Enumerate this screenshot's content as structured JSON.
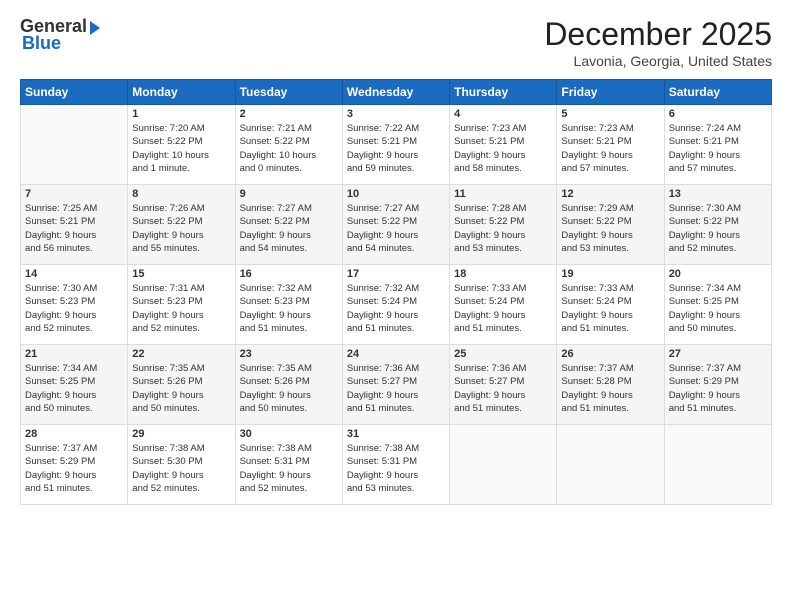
{
  "header": {
    "logo_general": "General",
    "logo_blue": "Blue",
    "month_year": "December 2025",
    "location": "Lavonia, Georgia, United States"
  },
  "weekdays": [
    "Sunday",
    "Monday",
    "Tuesday",
    "Wednesday",
    "Thursday",
    "Friday",
    "Saturday"
  ],
  "weeks": [
    [
      {
        "day": "",
        "info": ""
      },
      {
        "day": "1",
        "info": "Sunrise: 7:20 AM\nSunset: 5:22 PM\nDaylight: 10 hours\nand 1 minute."
      },
      {
        "day": "2",
        "info": "Sunrise: 7:21 AM\nSunset: 5:22 PM\nDaylight: 10 hours\nand 0 minutes."
      },
      {
        "day": "3",
        "info": "Sunrise: 7:22 AM\nSunset: 5:21 PM\nDaylight: 9 hours\nand 59 minutes."
      },
      {
        "day": "4",
        "info": "Sunrise: 7:23 AM\nSunset: 5:21 PM\nDaylight: 9 hours\nand 58 minutes."
      },
      {
        "day": "5",
        "info": "Sunrise: 7:23 AM\nSunset: 5:21 PM\nDaylight: 9 hours\nand 57 minutes."
      },
      {
        "day": "6",
        "info": "Sunrise: 7:24 AM\nSunset: 5:21 PM\nDaylight: 9 hours\nand 57 minutes."
      }
    ],
    [
      {
        "day": "7",
        "info": "Sunrise: 7:25 AM\nSunset: 5:21 PM\nDaylight: 9 hours\nand 56 minutes."
      },
      {
        "day": "8",
        "info": "Sunrise: 7:26 AM\nSunset: 5:22 PM\nDaylight: 9 hours\nand 55 minutes."
      },
      {
        "day": "9",
        "info": "Sunrise: 7:27 AM\nSunset: 5:22 PM\nDaylight: 9 hours\nand 54 minutes."
      },
      {
        "day": "10",
        "info": "Sunrise: 7:27 AM\nSunset: 5:22 PM\nDaylight: 9 hours\nand 54 minutes."
      },
      {
        "day": "11",
        "info": "Sunrise: 7:28 AM\nSunset: 5:22 PM\nDaylight: 9 hours\nand 53 minutes."
      },
      {
        "day": "12",
        "info": "Sunrise: 7:29 AM\nSunset: 5:22 PM\nDaylight: 9 hours\nand 53 minutes."
      },
      {
        "day": "13",
        "info": "Sunrise: 7:30 AM\nSunset: 5:22 PM\nDaylight: 9 hours\nand 52 minutes."
      }
    ],
    [
      {
        "day": "14",
        "info": "Sunrise: 7:30 AM\nSunset: 5:23 PM\nDaylight: 9 hours\nand 52 minutes."
      },
      {
        "day": "15",
        "info": "Sunrise: 7:31 AM\nSunset: 5:23 PM\nDaylight: 9 hours\nand 52 minutes."
      },
      {
        "day": "16",
        "info": "Sunrise: 7:32 AM\nSunset: 5:23 PM\nDaylight: 9 hours\nand 51 minutes."
      },
      {
        "day": "17",
        "info": "Sunrise: 7:32 AM\nSunset: 5:24 PM\nDaylight: 9 hours\nand 51 minutes."
      },
      {
        "day": "18",
        "info": "Sunrise: 7:33 AM\nSunset: 5:24 PM\nDaylight: 9 hours\nand 51 minutes."
      },
      {
        "day": "19",
        "info": "Sunrise: 7:33 AM\nSunset: 5:24 PM\nDaylight: 9 hours\nand 51 minutes."
      },
      {
        "day": "20",
        "info": "Sunrise: 7:34 AM\nSunset: 5:25 PM\nDaylight: 9 hours\nand 50 minutes."
      }
    ],
    [
      {
        "day": "21",
        "info": "Sunrise: 7:34 AM\nSunset: 5:25 PM\nDaylight: 9 hours\nand 50 minutes."
      },
      {
        "day": "22",
        "info": "Sunrise: 7:35 AM\nSunset: 5:26 PM\nDaylight: 9 hours\nand 50 minutes."
      },
      {
        "day": "23",
        "info": "Sunrise: 7:35 AM\nSunset: 5:26 PM\nDaylight: 9 hours\nand 50 minutes."
      },
      {
        "day": "24",
        "info": "Sunrise: 7:36 AM\nSunset: 5:27 PM\nDaylight: 9 hours\nand 51 minutes."
      },
      {
        "day": "25",
        "info": "Sunrise: 7:36 AM\nSunset: 5:27 PM\nDaylight: 9 hours\nand 51 minutes."
      },
      {
        "day": "26",
        "info": "Sunrise: 7:37 AM\nSunset: 5:28 PM\nDaylight: 9 hours\nand 51 minutes."
      },
      {
        "day": "27",
        "info": "Sunrise: 7:37 AM\nSunset: 5:29 PM\nDaylight: 9 hours\nand 51 minutes."
      }
    ],
    [
      {
        "day": "28",
        "info": "Sunrise: 7:37 AM\nSunset: 5:29 PM\nDaylight: 9 hours\nand 51 minutes."
      },
      {
        "day": "29",
        "info": "Sunrise: 7:38 AM\nSunset: 5:30 PM\nDaylight: 9 hours\nand 52 minutes."
      },
      {
        "day": "30",
        "info": "Sunrise: 7:38 AM\nSunset: 5:31 PM\nDaylight: 9 hours\nand 52 minutes."
      },
      {
        "day": "31",
        "info": "Sunrise: 7:38 AM\nSunset: 5:31 PM\nDaylight: 9 hours\nand 53 minutes."
      },
      {
        "day": "",
        "info": ""
      },
      {
        "day": "",
        "info": ""
      },
      {
        "day": "",
        "info": ""
      }
    ]
  ]
}
